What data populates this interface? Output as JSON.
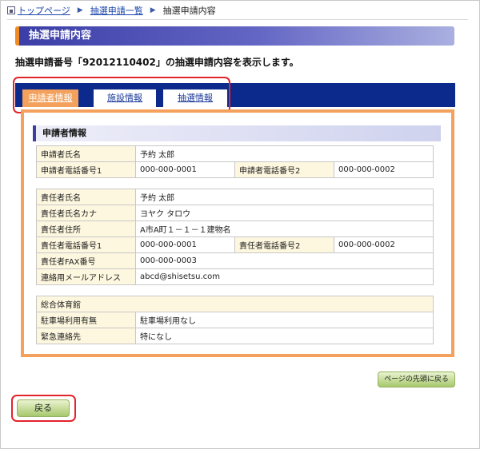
{
  "breadcrumb": {
    "items": [
      "トップページ",
      "抽選申請一覧"
    ],
    "current": "抽選申請内容"
  },
  "page_title": "抽選申請内容",
  "description": "抽選申請番号「92012110402」の抽選申請内容を表示します。",
  "tabs": [
    {
      "label": "申請者情報",
      "active": true
    },
    {
      "label": "施設情報",
      "active": false
    },
    {
      "label": "抽選情報",
      "active": false
    }
  ],
  "section_title": "申請者情報",
  "applicant": {
    "name_label": "申請者氏名",
    "name_value": "予約 太郎",
    "phone1_label": "申請者電話番号1",
    "phone1_value": "000-000-0001",
    "phone2_label": "申請者電話番号2",
    "phone2_value": "000-000-0002"
  },
  "responsible": {
    "name_label": "責任者氏名",
    "name_value": "予約 太郎",
    "kana_label": "責任者氏名カナ",
    "kana_value": "ヨヤク タロウ",
    "address_label": "責任者住所",
    "address_value": "A市A町１－１－１建物名",
    "phone1_label": "責任者電話番号1",
    "phone1_value": "000-000-0001",
    "phone2_label": "責任者電話番号2",
    "phone2_value": "000-000-0002",
    "fax_label": "責任者FAX番号",
    "fax_value": "000-000-0003",
    "email_label": "連絡用メールアドレス",
    "email_value": "abcd@shisetsu.com"
  },
  "facility": {
    "name": "総合体育館",
    "parking_label": "駐車場利用有無",
    "parking_value": "駐車場利用なし",
    "emergency_label": "緊急連絡先",
    "emergency_value": "特になし"
  },
  "buttons": {
    "page_top": "ページの先頭に戻る",
    "back": "戻る"
  },
  "colors": {
    "tab_band": "#0b2a8c",
    "active_tab": "#f3a15c",
    "highlight": "#e2242b",
    "label_cell": "#fdf7df",
    "button_green": "#a6c86c"
  }
}
